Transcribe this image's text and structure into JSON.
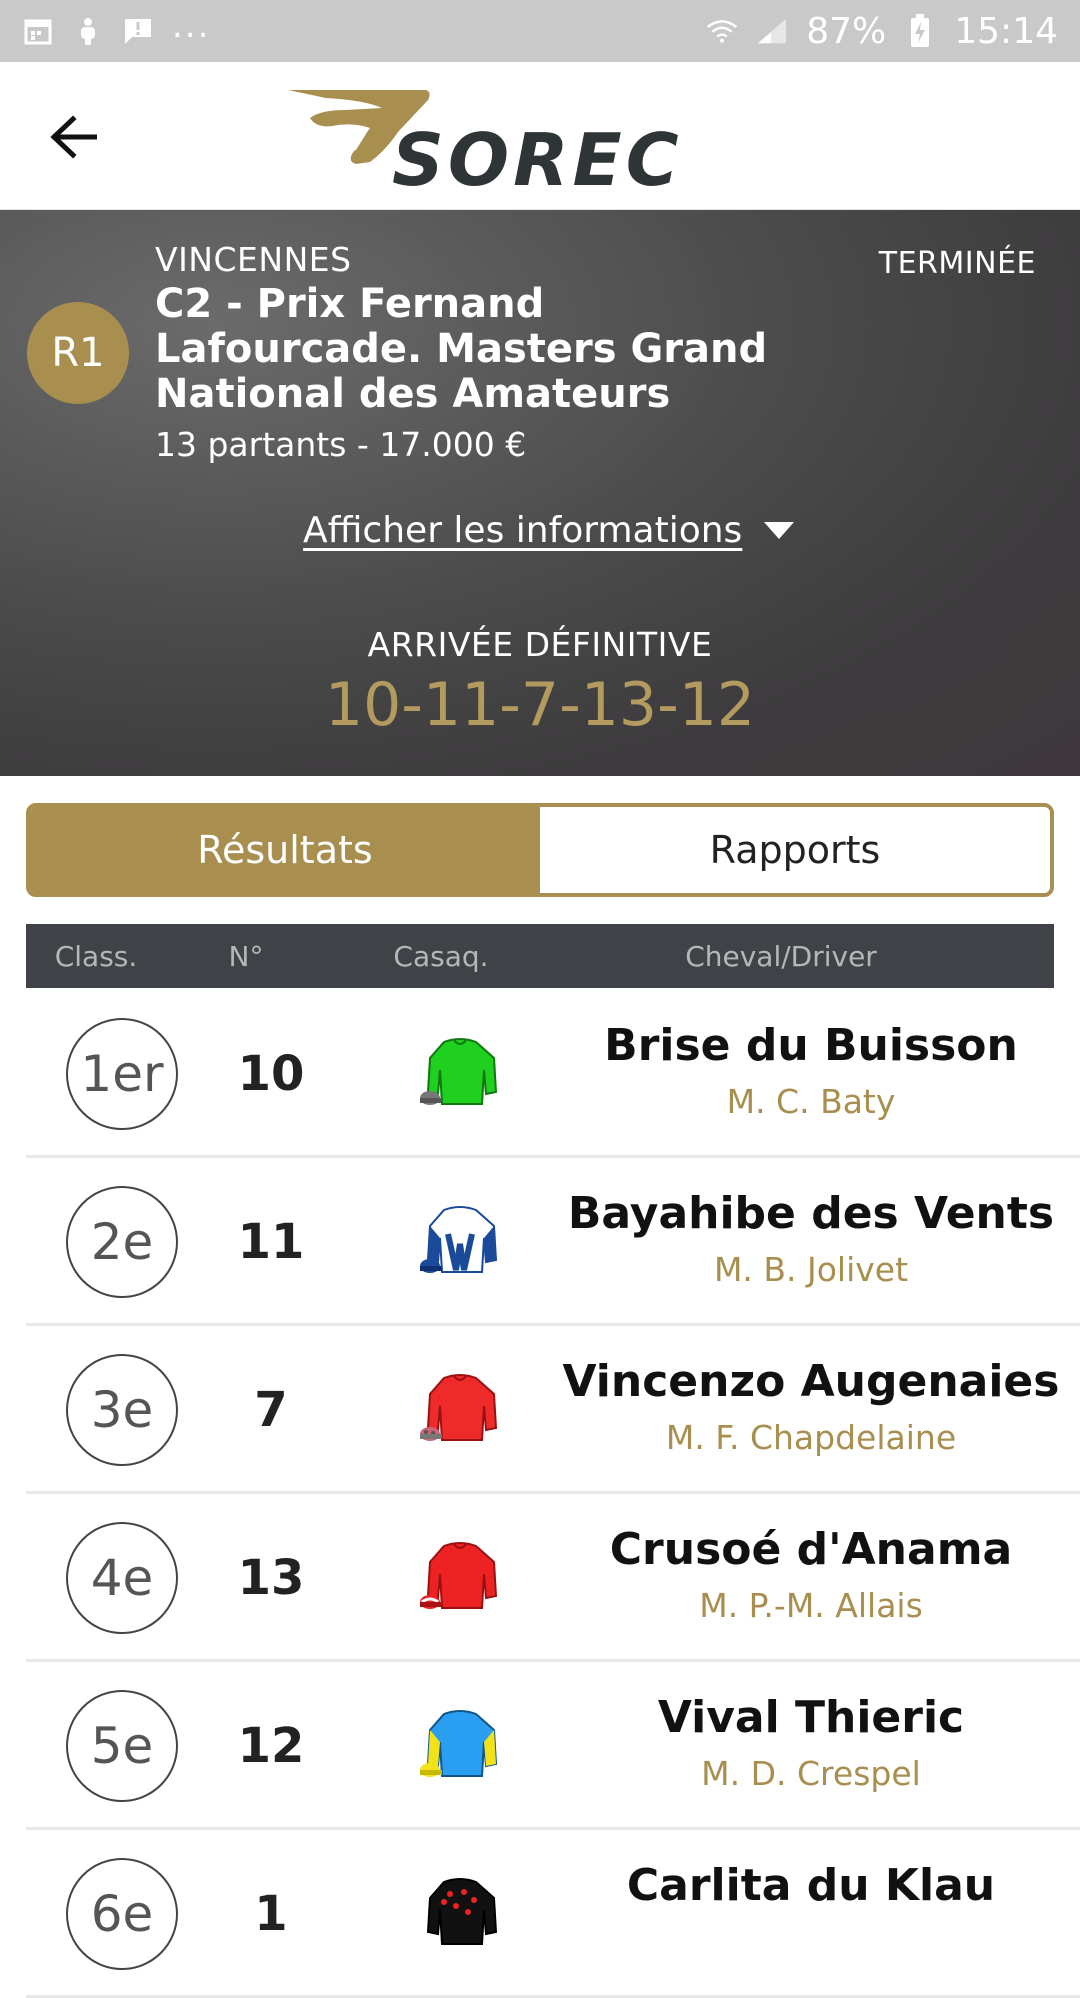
{
  "status_bar": {
    "battery": "87%",
    "time": "15:14",
    "dots": "..."
  },
  "header": {
    "logo_text": "SOREC",
    "colors": {
      "brand_gold": "#a88f4f",
      "logo_dark": "#2f3437"
    }
  },
  "race": {
    "reunion": "R1",
    "venue": "VINCENNES",
    "status": "TERMINÉE",
    "title": "C2 - Prix Fernand Lafourcade. Masters Grand National des Amateurs",
    "meta": "13 partants - 17.000 €",
    "info_link": "Afficher les informations",
    "arrivee_label": "ARRIVÉE DÉFINITIVE",
    "arrivee_value": "10-11-7-13-12"
  },
  "tabs": [
    {
      "label": "Résultats",
      "active": true
    },
    {
      "label": "Rapports",
      "active": false
    }
  ],
  "table": {
    "headers": {
      "class": "Class.",
      "num": "N°",
      "silk": "Casaq.",
      "horse": "Cheval/Driver"
    },
    "rows": [
      {
        "rank": "1er",
        "num": "10",
        "horse": "Brise du Buisson",
        "driver": "M. C. Baty",
        "silk_icon": "green-silk-icon"
      },
      {
        "rank": "2e",
        "num": "11",
        "horse": "Bayahibe des Vents",
        "driver": "M. B. Jolivet",
        "silk_icon": "blue-white-silk-icon"
      },
      {
        "rank": "3e",
        "num": "7",
        "horse": "Vincenzo Augenaies",
        "driver": "M. F. Chapdelaine",
        "silk_icon": "red-silk-icon"
      },
      {
        "rank": "4e",
        "num": "13",
        "horse": "Crusoé d'Anama",
        "driver": "M. P.-M. Allais",
        "silk_icon": "red-white-cap-silk-icon"
      },
      {
        "rank": "5e",
        "num": "12",
        "horse": "Vival Thieric",
        "driver": "M. D. Crespel",
        "silk_icon": "blue-yellow-silk-icon"
      },
      {
        "rank": "6e",
        "num": "1",
        "horse": "Carlita du Klau",
        "driver": "",
        "silk_icon": "black-red-dots-silk-icon"
      }
    ]
  }
}
